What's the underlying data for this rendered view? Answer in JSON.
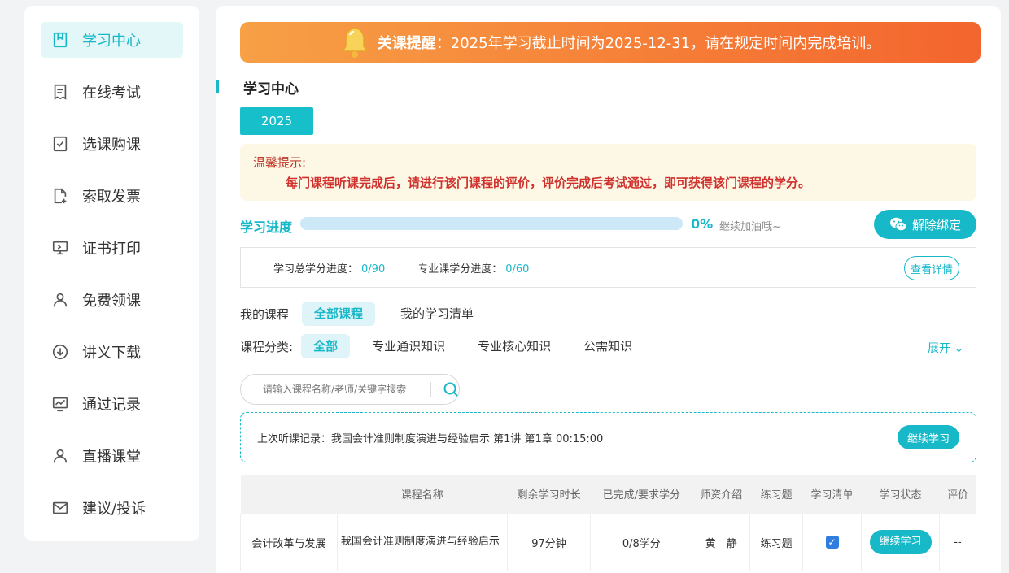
{
  "sidebar": {
    "items": [
      {
        "label": "学习中心",
        "icon": "book-icon",
        "active": true
      },
      {
        "label": "在线考试",
        "icon": "exam-icon",
        "active": false
      },
      {
        "label": "选课购课",
        "icon": "checkbox-icon",
        "active": false
      },
      {
        "label": "索取发票",
        "icon": "invoice-icon",
        "active": false
      },
      {
        "label": "证书打印",
        "icon": "certificate-icon",
        "active": false
      },
      {
        "label": "免费领课",
        "icon": "user-icon",
        "active": false
      },
      {
        "label": "讲义下载",
        "icon": "download-icon",
        "active": false
      },
      {
        "label": "通过记录",
        "icon": "chart-icon",
        "active": false
      },
      {
        "label": "直播课堂",
        "icon": "user-icon",
        "active": false
      },
      {
        "label": "建议/投诉",
        "icon": "mail-icon",
        "active": false
      }
    ]
  },
  "banner": {
    "prefix": "关课提醒",
    "text": "：2025年学习截止时间为2025-12-31，请在规定时间内完成培训。"
  },
  "main": {
    "title": "学习中心",
    "year": "2025",
    "tip_title": "温馨提示:",
    "tip_body": "每门课程听课完成后，请进行该门课程的评价，评价完成后考试通过，即可获得该门课程的学分。",
    "progress_label": "学习进度",
    "progress_value": 0,
    "progress_pct": "0%",
    "progress_hint": "继续加油哦~",
    "unbind_label": "解除绑定",
    "total_credit_label": "学习总学分进度：",
    "total_credit_value": "0/90",
    "major_credit_label": "专业课学分进度：",
    "major_credit_value": "0/60",
    "detail_label": "查看详情",
    "my_courses_label": "我的课程",
    "course_tabs": [
      "全部课程",
      "我的学习清单"
    ],
    "category_label": "课程分类:",
    "categories": [
      "全部",
      "专业通识知识",
      "专业核心知识",
      "公需知识"
    ],
    "expand_label": "展开",
    "search_placeholder": "请输入课程名称/老师/关键字搜索",
    "last_record": "上次听课记录：我国会计准则制度演进与经验启示 第1讲 第1章 00:15:00",
    "continue_label": "继续学习"
  },
  "table": {
    "headers": [
      "",
      "课程名称",
      "剩余学习时长",
      "已完成/要求学分",
      "师资介绍",
      "练习题",
      "学习清单",
      "学习状态",
      "评价"
    ],
    "rows": [
      {
        "category": "会计改革与发展",
        "name": "我国会计准则制度演进与经验启示",
        "remaining": "97分钟",
        "credits": "0/8学分",
        "teacher": "黄　静",
        "exercise": "练习题",
        "in_list": true,
        "status": "继续学习",
        "rating": "--"
      }
    ]
  },
  "colors": {
    "accent": "#17b8c8",
    "banner_start": "#f7a046",
    "banner_end": "#f3652e",
    "tip_text": "#d0312d"
  }
}
